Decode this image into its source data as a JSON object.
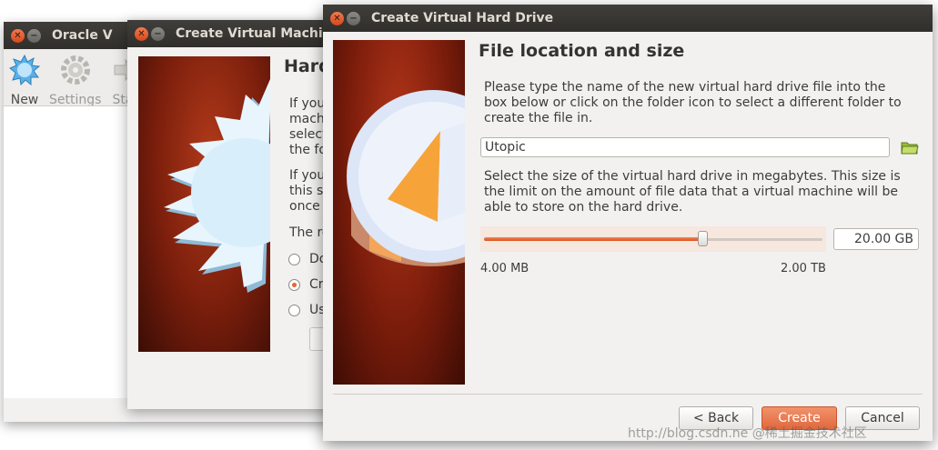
{
  "oracle_window": {
    "title": "Oracle V",
    "toolbar": [
      {
        "label": "New",
        "icon": "new-vm-icon",
        "enabled": true
      },
      {
        "label": "Settings",
        "icon": "gear-icon",
        "enabled": false
      },
      {
        "label": "Sta",
        "icon": "start-arrow-icon",
        "enabled": false
      }
    ]
  },
  "create_vm_window": {
    "title": "Create Virtual Machine",
    "heading_fragment": "Hard",
    "text_fragments": [
      "If you",
      "machi",
      "select",
      "the fo",
      "If you",
      "this s",
      "once",
      "The re"
    ],
    "options": [
      {
        "label": "Do",
        "selected": false
      },
      {
        "label": "Cr",
        "selected": true
      },
      {
        "label": "Us",
        "selected": false
      }
    ]
  },
  "hdd_window": {
    "title": "Create Virtual Hard Drive",
    "heading": "File location and size",
    "location_text": "Please type the name of the new virtual hard drive file into the box below or click on the folder icon to select a different folder to create the file in.",
    "file_name": "Utopic",
    "size_text": "Select the size of the virtual hard drive in megabytes. This size is the limit on the amount of file data that a virtual machine will be able to store on the hard drive.",
    "slider_fraction": 0.645,
    "size_value": "20.00 GB",
    "min_label": "4.00 MB",
    "max_label": "2.00 TB",
    "buttons": {
      "back": "< Back",
      "create": "Create",
      "cancel": "Cancel"
    }
  },
  "watermark": "http://blog.csdn.ne @稀土掘金技术社区",
  "colors": {
    "accent": "#e0683d",
    "titlebar": "#3a3935",
    "art_bg": "#7a1c0b"
  }
}
